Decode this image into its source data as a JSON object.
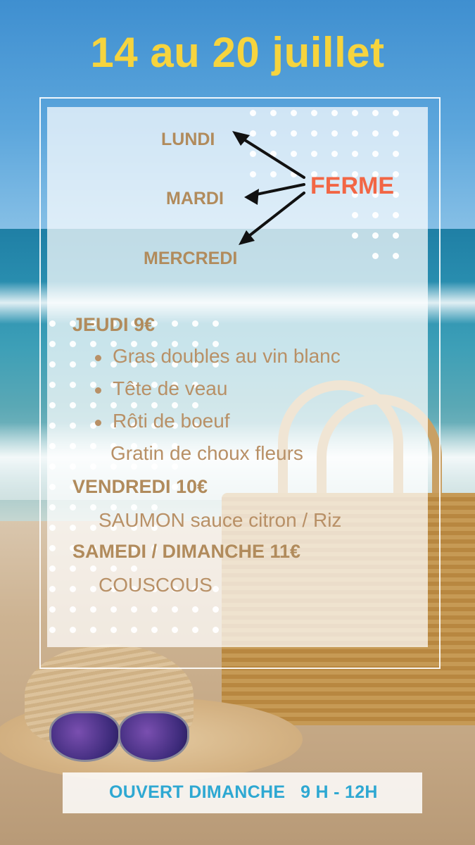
{
  "header": {
    "dates": "14 au 20 juillet"
  },
  "closed_days": {
    "days": [
      "LUNDI",
      "MARDI",
      "MERCREDI"
    ],
    "status": "FERME"
  },
  "menu": {
    "jeudi": {
      "heading": "JEUDI 9€",
      "items": [
        "Gras doubles au vin blanc",
        "Tête de veau",
        "Rôti de boeuf"
      ],
      "side": "Gratin de choux fleurs"
    },
    "vendredi": {
      "heading": "VENDREDI 10€",
      "item": "SAUMON sauce citron / Riz"
    },
    "weekend": {
      "heading": "SAMEDI / DIMANCHE 11€",
      "item": "COUSCOUS"
    }
  },
  "footer": {
    "open_label": "OUVERT DIMANCHE",
    "hours": "9 H - 12H"
  },
  "colors": {
    "title": "#f6d43e",
    "text": "#b18b5c",
    "closed": "#f26645",
    "open_banner_text": "#2ea8d2"
  }
}
